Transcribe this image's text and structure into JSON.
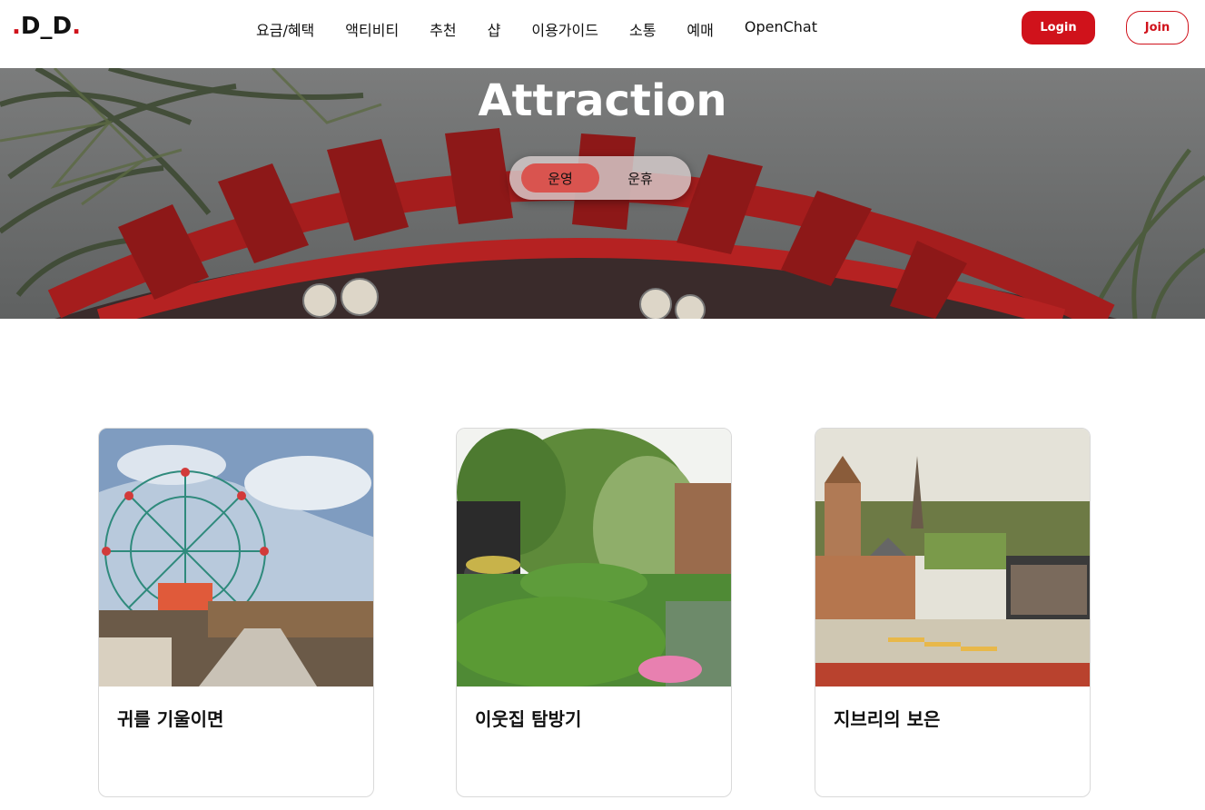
{
  "logo": {
    "text": "D_D"
  },
  "nav": {
    "items": [
      "요금/혜택",
      "액티비티",
      "추천",
      "샵",
      "이용가이드",
      "소통",
      "예매",
      "OpenChat"
    ]
  },
  "auth": {
    "login_label": "Login",
    "join_label": "Join"
  },
  "hero": {
    "title": "Attraction",
    "toggle": {
      "active": "운영",
      "inactive": "운휴"
    }
  },
  "cards": [
    {
      "title": "귀를 기울이면",
      "image": "ferris-wheel-photo"
    },
    {
      "title": "이웃집 탐방기",
      "image": "garden-train-photo"
    },
    {
      "title": "지브리의 보은",
      "image": "miniature-town-photo"
    }
  ],
  "colors": {
    "accent": "#d0121b",
    "toggle_active": "#d9544f"
  }
}
